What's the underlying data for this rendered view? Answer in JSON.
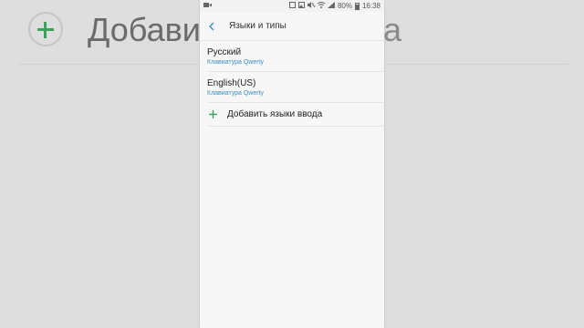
{
  "background": {
    "text_left": "Добавит",
    "text_right": "а"
  },
  "statusbar": {
    "battery": "80%",
    "time": "16:38"
  },
  "header": {
    "title": "Языки и типы"
  },
  "languages": [
    {
      "name": "Русский",
      "keyboard": "Клавиатура Qwerty"
    },
    {
      "name": "English(US)",
      "keyboard": "Клавиатура Qwerty"
    }
  ],
  "add": {
    "label": "Добавить языки ввода"
  },
  "colors": {
    "accent_blue": "#3b8fc4",
    "add_green": "#3aa35a"
  }
}
